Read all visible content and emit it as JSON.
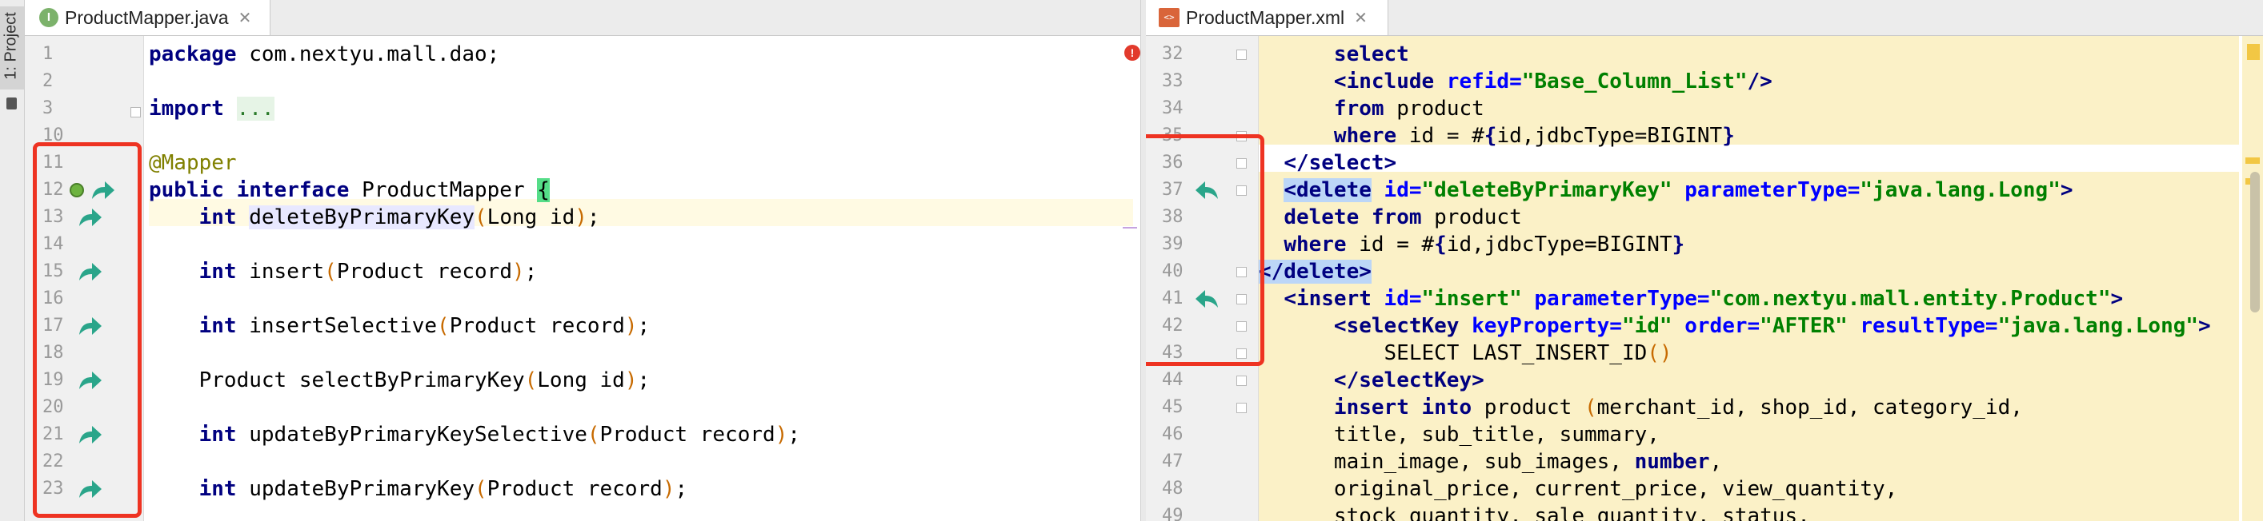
{
  "tool_window": {
    "project_tab": "1: Project"
  },
  "left_editor": {
    "tab": {
      "icon_letter": "I",
      "label": "ProductMapper.java",
      "close": "✕"
    },
    "line_numbers": [
      "1",
      "2",
      "3",
      "10",
      "11",
      "12",
      "13",
      "14",
      "15",
      "16",
      "17",
      "18",
      "19",
      "20",
      "21",
      "22",
      "23"
    ],
    "lines": [
      [
        {
          "t": "package",
          "c": "kw"
        },
        {
          "t": " com.nextyu.mall.dao;",
          "c": ""
        }
      ],
      [],
      [
        {
          "t": "import",
          "c": "kw"
        },
        {
          "t": " ",
          "c": ""
        },
        {
          "t": "...",
          "c": "fold"
        }
      ],
      [],
      [
        {
          "t": "@Mapper",
          "c": "ann"
        }
      ],
      [
        {
          "t": "public",
          "c": "kw"
        },
        {
          "t": " ",
          "c": ""
        },
        {
          "t": "interface",
          "c": "kw"
        },
        {
          "t": " ProductMapper ",
          "c": ""
        },
        {
          "t": "{",
          "c": "brace-hl"
        }
      ],
      [
        {
          "t": "    ",
          "c": ""
        },
        {
          "t": "int",
          "c": "kw"
        },
        {
          "t": " ",
          "c": ""
        },
        {
          "t": "deleteByPrimaryKey",
          "c": "sym"
        },
        {
          "t": "(",
          "c": "paren"
        },
        {
          "t": "Long id",
          "c": ""
        },
        {
          "t": ")",
          "c": "paren"
        },
        {
          "t": ";",
          "c": ""
        }
      ],
      [],
      [
        {
          "t": "    ",
          "c": ""
        },
        {
          "t": "int",
          "c": "kw"
        },
        {
          "t": " insert",
          "c": ""
        },
        {
          "t": "(",
          "c": "paren"
        },
        {
          "t": "Product record",
          "c": ""
        },
        {
          "t": ")",
          "c": "paren"
        },
        {
          "t": ";",
          "c": ""
        }
      ],
      [],
      [
        {
          "t": "    ",
          "c": ""
        },
        {
          "t": "int",
          "c": "kw"
        },
        {
          "t": " insertSelective",
          "c": ""
        },
        {
          "t": "(",
          "c": "paren"
        },
        {
          "t": "Product record",
          "c": ""
        },
        {
          "t": ")",
          "c": "paren"
        },
        {
          "t": ";",
          "c": ""
        }
      ],
      [],
      [
        {
          "t": "    Product selectByPrimaryKey",
          "c": ""
        },
        {
          "t": "(",
          "c": "paren"
        },
        {
          "t": "Long id",
          "c": ""
        },
        {
          "t": ")",
          "c": "paren"
        },
        {
          "t": ";",
          "c": ""
        }
      ],
      [],
      [
        {
          "t": "    ",
          "c": ""
        },
        {
          "t": "int",
          "c": "kw"
        },
        {
          "t": " updateByPrimaryKeySelective",
          "c": ""
        },
        {
          "t": "(",
          "c": "paren"
        },
        {
          "t": "Product record",
          "c": ""
        },
        {
          "t": ")",
          "c": "paren"
        },
        {
          "t": ";",
          "c": ""
        }
      ],
      [],
      [
        {
          "t": "    ",
          "c": ""
        },
        {
          "t": "int",
          "c": "kw"
        },
        {
          "t": " updateByPrimaryKey",
          "c": ""
        },
        {
          "t": "(",
          "c": "paren"
        },
        {
          "t": "Product record",
          "c": ""
        },
        {
          "t": ")",
          "c": "paren"
        },
        {
          "t": ";",
          "c": ""
        }
      ]
    ]
  },
  "right_editor": {
    "tab": {
      "icon_text": "<>",
      "label": "ProductMapper.xml",
      "close": "✕"
    },
    "line_numbers": [
      "32",
      "33",
      "34",
      "35",
      "36",
      "37",
      "38",
      "39",
      "40",
      "41",
      "42",
      "43",
      "44",
      "45",
      "46",
      "47",
      "48",
      "49"
    ],
    "lines": [
      [
        {
          "t": "      select",
          "c": "kw"
        }
      ],
      [
        {
          "t": "      ",
          "c": ""
        },
        {
          "t": "<include",
          "c": "tag"
        },
        {
          "t": " refid=",
          "c": "attr"
        },
        {
          "t": "\"Base_Column_List\"",
          "c": "str"
        },
        {
          "t": "/>",
          "c": "tag"
        }
      ],
      [
        {
          "t": "      ",
          "c": ""
        },
        {
          "t": "from",
          "c": "kw"
        },
        {
          "t": " product",
          "c": ""
        }
      ],
      [
        {
          "t": "      ",
          "c": ""
        },
        {
          "t": "where",
          "c": "kw"
        },
        {
          "t": " id = #",
          "c": ""
        },
        {
          "t": "{",
          "c": "tag"
        },
        {
          "t": "id,jdbcType=BIGINT",
          "c": ""
        },
        {
          "t": "}",
          "c": "tag"
        }
      ],
      [
        {
          "t": "  ",
          "c": ""
        },
        {
          "t": "</select>",
          "c": "tag"
        }
      ],
      [
        {
          "t": "  ",
          "c": ""
        },
        {
          "t": "<delete",
          "c": "tag tag-hl"
        },
        {
          "t": " id=",
          "c": "attr"
        },
        {
          "t": "\"deleteByPrimaryKey\"",
          "c": "str"
        },
        {
          "t": " parameterType=",
          "c": "attr"
        },
        {
          "t": "\"java.lang.Long\"",
          "c": "str"
        },
        {
          "t": ">",
          "c": "tag"
        }
      ],
      [
        {
          "t": "  ",
          "c": ""
        },
        {
          "t": "delete from",
          "c": "kw"
        },
        {
          "t": " product",
          "c": ""
        }
      ],
      [
        {
          "t": "  ",
          "c": ""
        },
        {
          "t": "where",
          "c": "kw"
        },
        {
          "t": " id = #",
          "c": ""
        },
        {
          "t": "{",
          "c": "tag"
        },
        {
          "t": "id,jdbcType=BIGINT",
          "c": ""
        },
        {
          "t": "}",
          "c": "tag"
        }
      ],
      [
        {
          "t": "</delete>",
          "c": "tag tag-hl"
        }
      ],
      [
        {
          "t": "  ",
          "c": ""
        },
        {
          "t": "<insert",
          "c": "tag"
        },
        {
          "t": " id=",
          "c": "attr"
        },
        {
          "t": "\"insert\"",
          "c": "str"
        },
        {
          "t": " parameterType=",
          "c": "attr"
        },
        {
          "t": "\"com.nextyu.mall.entity.Product\"",
          "c": "str"
        },
        {
          "t": ">",
          "c": "tag"
        }
      ],
      [
        {
          "t": "      ",
          "c": ""
        },
        {
          "t": "<selectKey",
          "c": "tag"
        },
        {
          "t": " keyProperty=",
          "c": "attr"
        },
        {
          "t": "\"id\"",
          "c": "str"
        },
        {
          "t": " order=",
          "c": "attr"
        },
        {
          "t": "\"AFTER\"",
          "c": "str"
        },
        {
          "t": " resultType=",
          "c": "attr"
        },
        {
          "t": "\"java.lang.Long\"",
          "c": "str"
        },
        {
          "t": ">",
          "c": "tag"
        }
      ],
      [
        {
          "t": "          SELECT LAST_INSERT_ID",
          "c": ""
        },
        {
          "t": "()",
          "c": "paren"
        }
      ],
      [
        {
          "t": "      ",
          "c": ""
        },
        {
          "t": "</selectKey>",
          "c": "tag"
        }
      ],
      [
        {
          "t": "      ",
          "c": ""
        },
        {
          "t": "insert into",
          "c": "kw"
        },
        {
          "t": " product ",
          "c": ""
        },
        {
          "t": "(",
          "c": "paren"
        },
        {
          "t": "merchant_id, shop_id, category_id,",
          "c": ""
        }
      ],
      [
        {
          "t": "      title, sub_title, summary,",
          "c": ""
        }
      ],
      [
        {
          "t": "      main_image, sub_images, ",
          "c": ""
        },
        {
          "t": "number",
          "c": "kw"
        },
        {
          "t": ",",
          "c": ""
        }
      ],
      [
        {
          "t": "      original_price, current_price, view_quantity,",
          "c": ""
        }
      ],
      [
        {
          "t": "      stock_quantity, sale_quantity, status,",
          "c": ""
        }
      ]
    ]
  },
  "colors": {
    "implement_arrow": "#2aa58a",
    "highlight_box": "#ee3322",
    "xml_background": "#fbf1c7",
    "error_marker": "#e23a2c"
  }
}
